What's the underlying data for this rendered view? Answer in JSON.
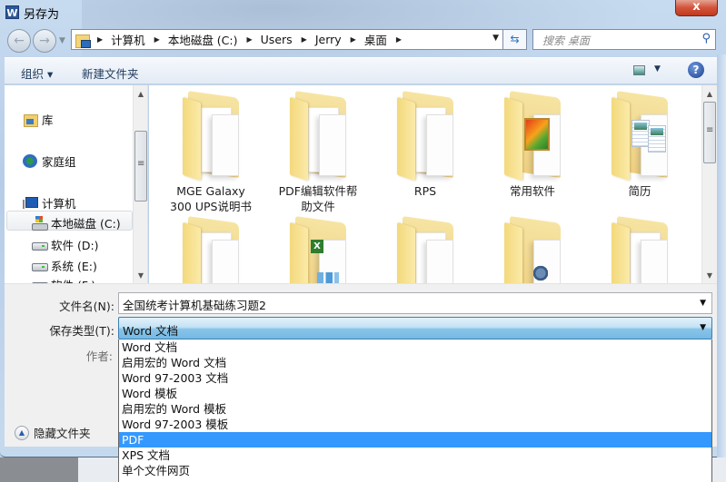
{
  "window": {
    "title": "另存为",
    "app_icon": "word-icon",
    "close_label": "x"
  },
  "navigation": {
    "back": "back-arrow-icon",
    "forward": "forward-arrow-icon",
    "breadcrumbs": [
      "计算机",
      "本地磁盘 (C:)",
      "Users",
      "Jerry",
      "桌面"
    ],
    "search_placeholder": "搜索 桌面"
  },
  "toolbar": {
    "organize_label": "组织 ▾",
    "new_folder_label": "新建文件夹",
    "help_label": "?"
  },
  "sidebar": {
    "items": [
      {
        "label": "库",
        "icon": "library-icon"
      },
      {
        "label": "家庭组",
        "icon": "homegroup-icon"
      },
      {
        "label": "计算机",
        "icon": "computer-icon"
      },
      {
        "label": "本地磁盘 (C:)",
        "icon": "system-drive-icon",
        "selected": true
      },
      {
        "label": "软件 (D:)",
        "icon": "drive-icon"
      },
      {
        "label": "系统 (E:)",
        "icon": "drive-icon"
      },
      {
        "label": "软件 (F:)",
        "icon": "drive-icon"
      }
    ]
  },
  "files": {
    "row1": [
      {
        "name": "MGE Galaxy\n300 UPS说明书",
        "line1": "MGE Galaxy",
        "line2": "300 UPS说明书"
      },
      {
        "name": "PDF编辑软件帮助文件",
        "line1": "PDF编辑软件帮",
        "line2": "助文件"
      },
      {
        "name": "RPS",
        "line1": "RPS",
        "line2": ""
      },
      {
        "name": "常用软件",
        "line1": "常用软件",
        "line2": ""
      },
      {
        "name": "简历",
        "line1": "简历",
        "line2": ""
      }
    ],
    "row2_count": 5
  },
  "form": {
    "filename_label": "文件名(N):",
    "filename_value": "全国统考计算机基础练习题2",
    "type_label": "保存类型(T):",
    "type_value": "Word 文档",
    "author_label": "作者:",
    "hide_folders_label": "隐藏文件夹"
  },
  "type_options": [
    {
      "label": "Word 文档",
      "selected": false
    },
    {
      "label": "启用宏的 Word 文档",
      "selected": false
    },
    {
      "label": "Word 97-2003 文档",
      "selected": false
    },
    {
      "label": "Word 模板",
      "selected": false
    },
    {
      "label": "启用宏的 Word 模板",
      "selected": false
    },
    {
      "label": "Word 97-2003 模板",
      "selected": false
    },
    {
      "label": "PDF",
      "selected": true
    },
    {
      "label": "XPS 文档",
      "selected": false
    },
    {
      "label": "单个文件网页",
      "selected": false
    }
  ],
  "colors": {
    "highlight": "#3399ff",
    "select_border": "#3c7fb1"
  }
}
